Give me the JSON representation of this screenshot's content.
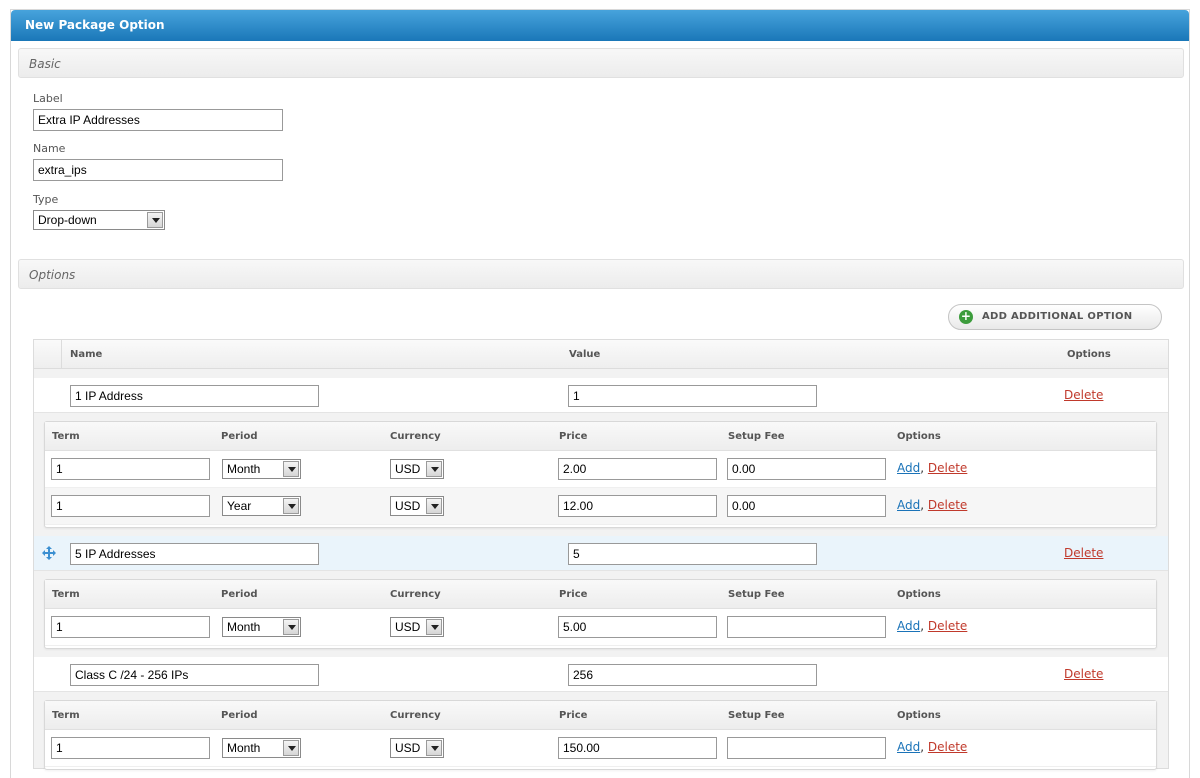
{
  "panel": {
    "title": "New Package Option"
  },
  "basic": {
    "heading": "Basic",
    "label_label": "Label",
    "label_value": "Extra IP Addresses",
    "name_label": "Name",
    "name_value": "extra_ips",
    "type_label": "Type",
    "type_value": "Drop-down"
  },
  "options": {
    "heading": "Options",
    "add_button": "ADD ADDITIONAL OPTION",
    "columns": {
      "name": "Name",
      "value": "Value",
      "options": "Options"
    },
    "sub_columns": {
      "term": "Term",
      "period": "Period",
      "currency": "Currency",
      "price": "Price",
      "setup_fee": "Setup Fee",
      "options": "Options"
    },
    "delete_label": "Delete",
    "add_label": "Add",
    "separator": ",",
    "items": [
      {
        "name": "1 IP Address",
        "value": "1",
        "pricing": [
          {
            "term": "1",
            "period": "Month",
            "currency": "USD",
            "price": "2.00",
            "setup_fee": "0.00"
          },
          {
            "term": "1",
            "period": "Year",
            "currency": "USD",
            "price": "12.00",
            "setup_fee": "0.00"
          }
        ]
      },
      {
        "name": "5 IP Addresses",
        "value": "5",
        "pricing": [
          {
            "term": "1",
            "period": "Month",
            "currency": "USD",
            "price": "5.00",
            "setup_fee": ""
          }
        ]
      },
      {
        "name": "Class C /24 - 256 IPs",
        "value": "256",
        "pricing": [
          {
            "term": "1",
            "period": "Month",
            "currency": "USD",
            "price": "150.00",
            "setup_fee": ""
          }
        ]
      }
    ]
  },
  "colors": {
    "header_blue": "#2a86c6",
    "delete_red": "#c0392b",
    "link_blue": "#1a73b8",
    "add_green": "#3c9c3c"
  }
}
